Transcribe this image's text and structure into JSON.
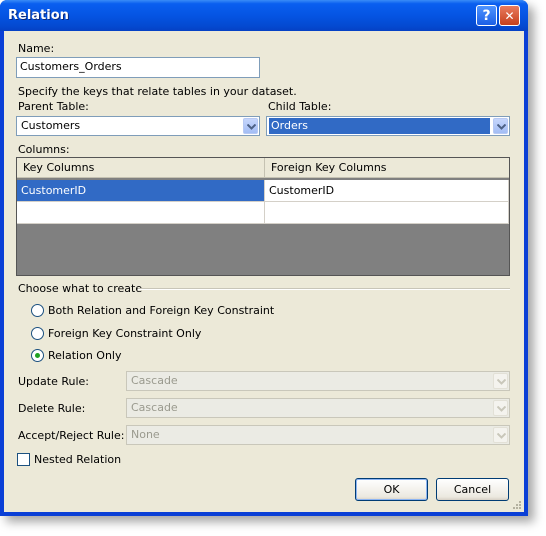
{
  "window": {
    "title": "Relation",
    "help_glyph": "?",
    "close_glyph": "✕"
  },
  "name": {
    "label": "Name:",
    "value": "Customers_Orders"
  },
  "hint": "Specify the keys that relate tables in your dataset.",
  "parent": {
    "label": "Parent Table:",
    "value": "Customers"
  },
  "child": {
    "label": "Child Table:",
    "value": "Orders"
  },
  "columns": {
    "label": "Columns:",
    "headers": [
      "Key Columns",
      "Foreign Key Columns"
    ],
    "rows": [
      [
        "CustomerID",
        "CustomerID"
      ],
      [
        "",
        ""
      ]
    ]
  },
  "create": {
    "label": "Choose what to create",
    "options": [
      {
        "label": "Both Relation and Foreign Key Constraint",
        "selected": false
      },
      {
        "label": "Foreign Key Constraint Only",
        "selected": false
      },
      {
        "label": "Relation Only",
        "selected": true
      }
    ]
  },
  "rules": {
    "update": {
      "label": "Update Rule:",
      "value": "Cascade"
    },
    "delete": {
      "label": "Delete Rule:",
      "value": "Cascade"
    },
    "accept": {
      "label": "Accept/Reject Rule:",
      "value": "None"
    }
  },
  "nested": {
    "label": "Nested Relation",
    "checked": false
  },
  "buttons": {
    "ok": "OK",
    "cancel": "Cancel"
  },
  "colors": {
    "title_bar": "#0554e3",
    "selection": "#316ac5",
    "dialog_bg": "#ece9d8"
  }
}
